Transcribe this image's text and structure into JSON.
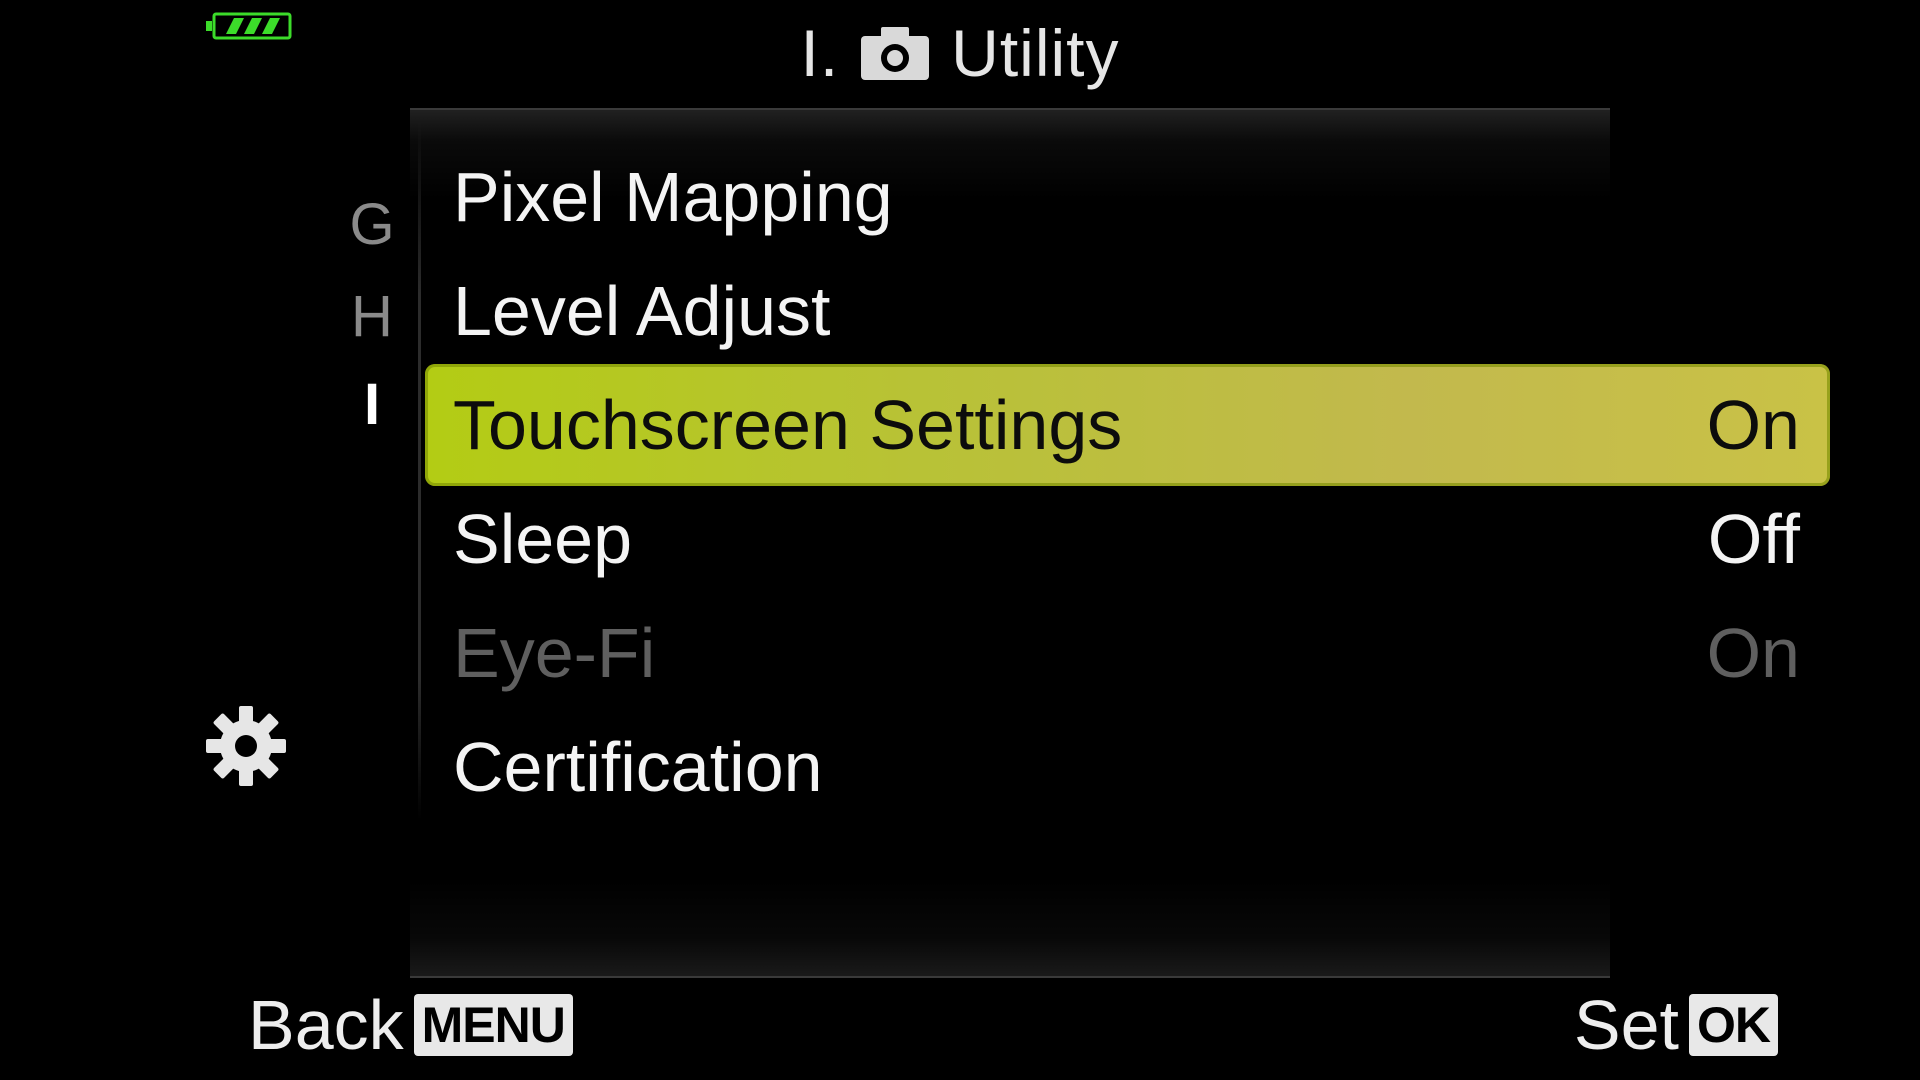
{
  "status": {
    "battery_icon": "battery-full-icon",
    "battery_color": "#3cdc2a"
  },
  "header": {
    "section_prefix": "I.",
    "camera_icon": "camera-icon",
    "title": "Utility"
  },
  "tabs": [
    {
      "letter": "G"
    },
    {
      "letter": "H"
    },
    {
      "letter": "I"
    }
  ],
  "sidebar": {
    "settings_icon": "gear-icon"
  },
  "menu": {
    "items": [
      {
        "label": "Pixel Mapping",
        "value": ""
      },
      {
        "label": "Level Adjust",
        "value": ""
      },
      {
        "label": "Touchscreen Settings",
        "value": "On"
      },
      {
        "label": "Sleep",
        "value": "Off"
      },
      {
        "label": "Eye-Fi",
        "value": "On"
      },
      {
        "label": "Certification",
        "value": ""
      }
    ],
    "highlight_color": "#b8c236"
  },
  "footer": {
    "back_label": "Back",
    "back_key": "MENU",
    "set_label": "Set",
    "set_key": "OK"
  }
}
